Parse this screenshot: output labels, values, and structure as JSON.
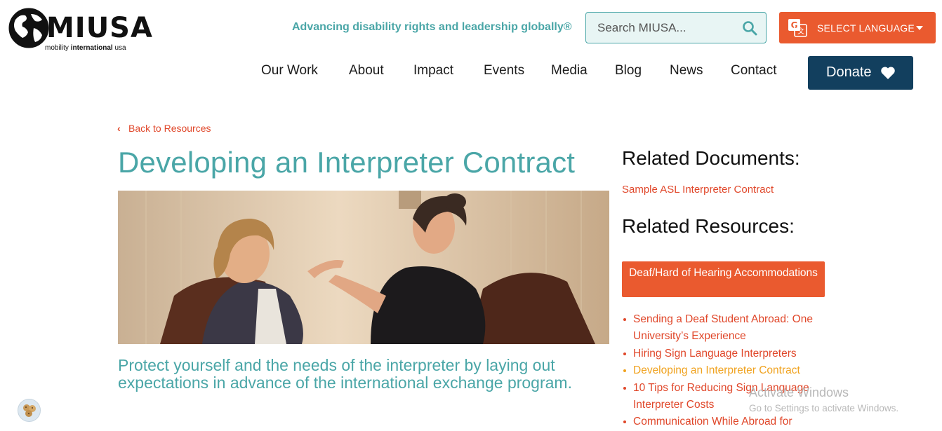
{
  "brand": {
    "wordmark": "MIUSA",
    "subtitle_plain": "mobility ",
    "subtitle_bold": "international",
    "subtitle_end": " usa"
  },
  "header": {
    "tagline": "Advancing disability rights and leadership globally®",
    "search_placeholder": "Search MIUSA...",
    "language_label": "SELECT LANGUAGE",
    "donate_label": "Donate"
  },
  "nav": {
    "items": [
      "Our Work",
      "About",
      "Impact",
      "Events",
      "Media",
      "Blog",
      "News",
      "Contact"
    ]
  },
  "main": {
    "back_label": "Back to Resources",
    "title": "Developing an Interpreter Contract",
    "lede": "Protect yourself and the needs of the interpreter by laying out expectations in advance of the international exchange program."
  },
  "sidebar": {
    "related_documents_heading": "Related Documents:",
    "related_document": "Sample ASL Interpreter Contract",
    "related_resources_heading": "Related Resources:",
    "category_button": "Deaf/Hard of Hearing Accommodations",
    "resources": [
      "Sending a Deaf Student Abroad: One University’s Experience",
      "Hiring Sign Language Interpreters",
      "Developing an Interpreter Contract",
      "10 Tips for Reducing Sign Language Interpreter Costs",
      "Communication While Abroad for"
    ]
  },
  "watermark": {
    "line1": "Activate Windows",
    "line2": "Go to Settings to activate Windows."
  },
  "colors": {
    "teal": "#4aa6a7",
    "orange": "#ea5a2f",
    "navy": "#123f5e",
    "link": "#e0472a",
    "current": "#f0a21e"
  }
}
